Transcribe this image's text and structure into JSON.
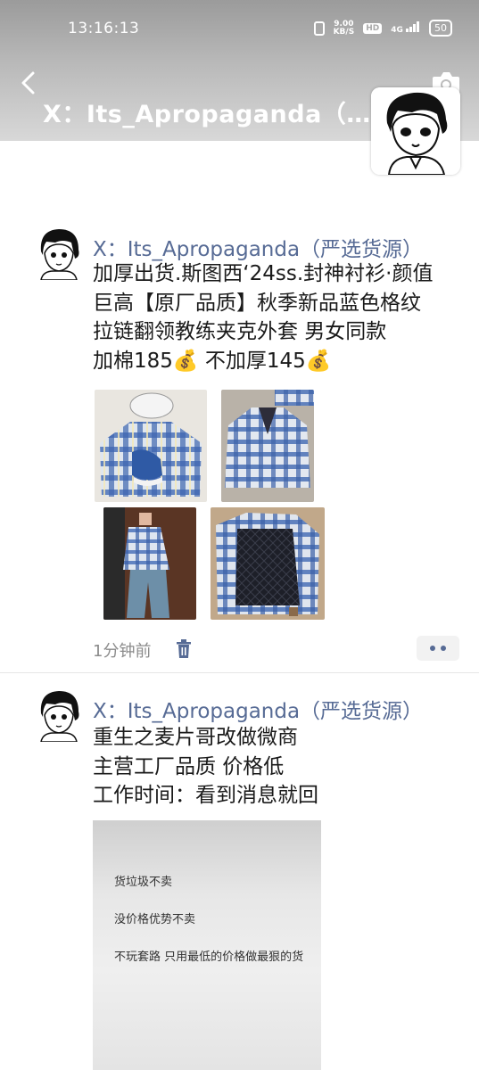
{
  "status_bar": {
    "time": "13:16:13",
    "speed_value": "9.00",
    "speed_unit": "KB/S",
    "hd": "HD",
    "network": "4G",
    "battery": "50"
  },
  "header": {
    "title": "X：Its_Apropaganda（…",
    "back_icon": "back-chevron-icon",
    "camera_icon": "camera-icon"
  },
  "posts": [
    {
      "author": "X：Its_Apropaganda（严选货源）",
      "content": "加厚出货.斯图西‘24ss.封神衬衫·颜值\n巨高【原厂品质】秋季新品蓝色格纹\n拉链翻领教练夹克外套 男女同款\n加棉185💰 不加厚145💰",
      "time": "1分钟前",
      "photos": [
        "blue plaid jacket with sneakers and cap",
        "plaid jacket laid flat",
        "person wearing plaid jacket",
        "quilted lining of plaid jacket"
      ]
    },
    {
      "author": "X：Its_Apropaganda（严选货源）",
      "content": "重生之麦片哥改做微商\n主营工厂品质 价格低\n工作时间：看到消息就回",
      "poster_lines": [
        "货垃圾不卖",
        "没价格优势不卖",
        "不玩套路 只用最低的价格做最狠的货"
      ]
    }
  ],
  "colors": {
    "author_link": "#576b95",
    "header_gradient_top": "#9b9b9b",
    "plaid_blue": "#3f66b0"
  }
}
